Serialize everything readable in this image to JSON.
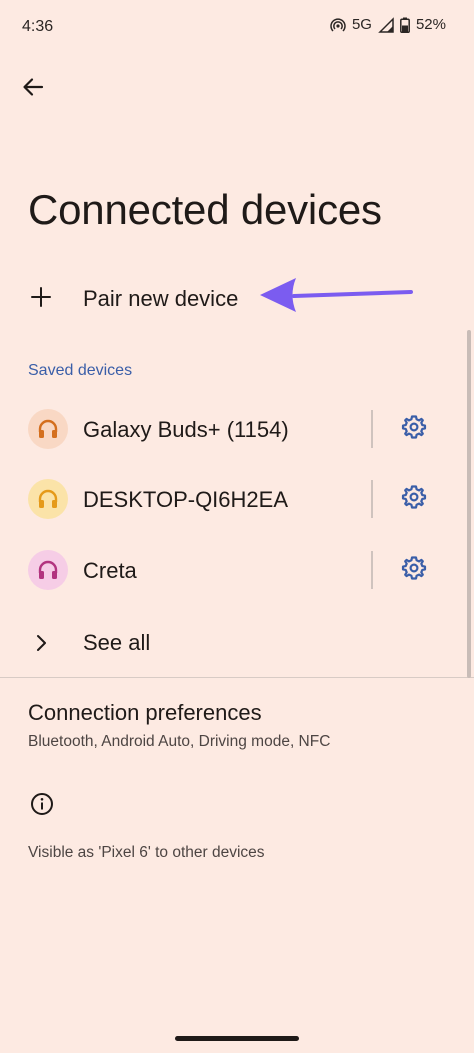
{
  "status_bar": {
    "time": "4:36",
    "network": "5G",
    "battery": "52%",
    "icons": [
      "hotspot-icon",
      "signal-icon",
      "battery-icon"
    ]
  },
  "header": {
    "back_icon": "arrow-back-icon",
    "title": "Connected devices"
  },
  "pair": {
    "label": "Pair new device",
    "icon": "plus-icon",
    "annotation_arrow_color": "#7b5cf0"
  },
  "saved_devices": {
    "header": "Saved devices",
    "items": [
      {
        "name": "Galaxy Buds+ (1154)",
        "icon": "headset-icon",
        "icon_bg": "#f9d8c4",
        "icon_color": "#d46f1e"
      },
      {
        "name": "DESKTOP-QI6H2EA",
        "icon": "headset-icon",
        "icon_bg": "#fbe3a8",
        "icon_color": "#e59a1a"
      },
      {
        "name": "Creta",
        "icon": "headset-icon",
        "icon_bg": "#f6cde6",
        "icon_color": "#b2347f"
      }
    ],
    "settings_icon": "gear-icon",
    "settings_color": "#3a5ea8"
  },
  "see_all": {
    "label": "See all",
    "icon": "chevron-right-icon"
  },
  "connection_preferences": {
    "title": "Connection preferences",
    "subtitle": "Bluetooth, Android Auto, Driving mode, NFC"
  },
  "footer": {
    "info_icon": "info-icon",
    "visible_as": "Visible as 'Pixel 6' to other devices"
  },
  "colors": {
    "background": "#fdeae2",
    "accent": "#3a5ea8",
    "text": "#1f1a18"
  }
}
